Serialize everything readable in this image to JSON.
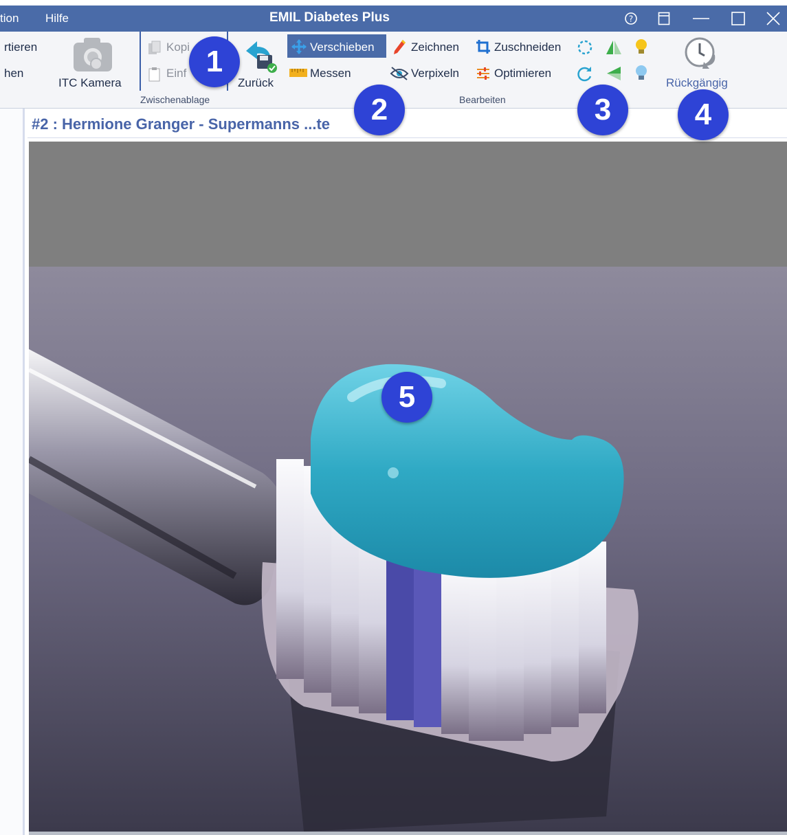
{
  "window": {
    "title": "EMIL Diabetes Plus"
  },
  "menu": [
    "tion",
    "Hilfe"
  ],
  "ribbon": {
    "left_items": [
      "rtieren",
      "hen"
    ],
    "camera_label": "ITC Kamera",
    "clipboard": {
      "copy": "Kopi",
      "paste": "Einf"
    },
    "back_label": "Zurück",
    "edit": {
      "move": "Verschieben",
      "measure": "Messen",
      "draw": "Zeichnen",
      "pixelate": "Verpixeln",
      "crop": "Zuschneiden",
      "optimize": "Optimieren"
    },
    "groups": {
      "clipboard": "Zwischenablage",
      "edit": "Bearbeiten"
    },
    "undo_label": "Rückgängig"
  },
  "document": {
    "title": "#2 : Hermione Granger - Supermanns ...te"
  },
  "callouts": [
    "1",
    "2",
    "3",
    "4",
    "5"
  ],
  "colors": {
    "titlebar": "#4a6ba8",
    "selected": "#4a6ba8",
    "badge": "#2e43d6",
    "title_text": "#4864a8"
  }
}
